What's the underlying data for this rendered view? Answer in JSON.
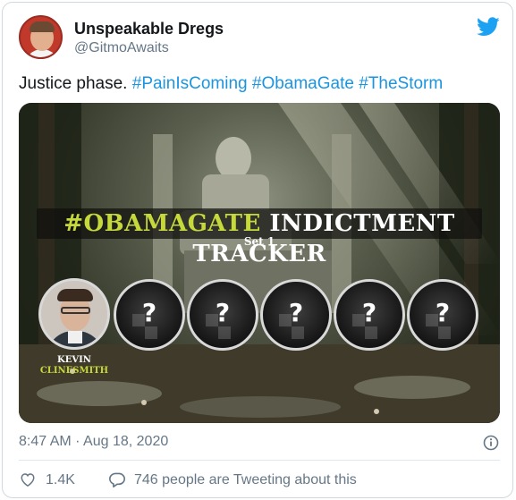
{
  "user": {
    "display_name": "Unspeakable Dregs",
    "handle": "@GitmoAwaits"
  },
  "tweet": {
    "text_plain": "Justice phase.",
    "hashtags": [
      "#PainIsComing",
      "#ObamaGate",
      "#TheStorm"
    ]
  },
  "media": {
    "banner_highlight": "#OBAMAGATE",
    "banner_rest": " INDICTMENT TRACKER",
    "set_label": "Set 1",
    "featured_first_name": "KEVIN",
    "featured_last_name": "CLINESMITH",
    "unknown_mark": "?",
    "unknown_slots": 5
  },
  "footer": {
    "timestamp": "8:47 AM · Aug 18, 2020",
    "like_count": "1.4K",
    "conversation": "746 people are Tweeting about this"
  },
  "colors": {
    "hashtag": "#1b95e0",
    "twitter_blue": "#1da1f2",
    "banner_highlight": "#c6d93a",
    "muted_text": "#657786"
  },
  "icons": [
    "twitter-bird-icon",
    "info-icon",
    "heart-icon",
    "reply-bubble-icon"
  ]
}
